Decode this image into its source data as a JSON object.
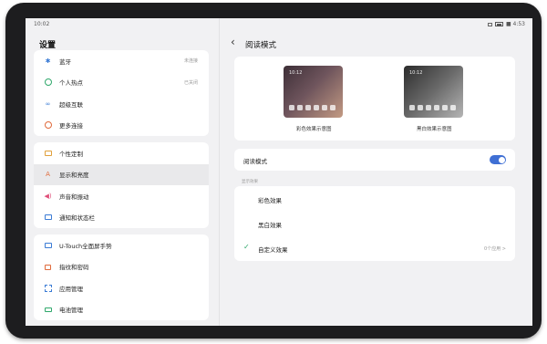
{
  "statusbar": {
    "time": "10:02",
    "battery": "■ 4:53"
  },
  "sidebar": {
    "title": "设置",
    "group1": [
      {
        "icon": "bluetooth-icon",
        "label": "蓝牙",
        "value": "未连接"
      },
      {
        "icon": "hotspot-icon",
        "label": "个人热点",
        "value": "已关闭"
      },
      {
        "icon": "super-interconnect-icon",
        "label": "超级互联",
        "value": ""
      },
      {
        "icon": "more-connections-icon",
        "label": "更多连接",
        "value": ""
      }
    ],
    "group2": [
      {
        "icon": "personalization-icon",
        "label": "个性定制"
      },
      {
        "icon": "display-brightness-icon",
        "label": "显示和亮度"
      },
      {
        "icon": "sound-vibration-icon",
        "label": "声音和振动"
      },
      {
        "icon": "notification-statusbar-icon",
        "label": "通知和状态栏"
      }
    ],
    "group3": [
      {
        "icon": "utouch-icon",
        "label": "U-Touch全面屏手势"
      },
      {
        "icon": "fingerprint-password-icon",
        "label": "指纹和密码"
      },
      {
        "icon": "app-management-icon",
        "label": "应用管理"
      },
      {
        "icon": "battery-management-icon",
        "label": "电池管理"
      }
    ]
  },
  "detail": {
    "title": "阅读模式",
    "preview": {
      "thumb_time": "10:12",
      "color_caption": "彩色效果示意图",
      "bw_caption": "黑白效果示意图"
    },
    "toggle_label": "阅读模式",
    "toggle_on": true,
    "section_label": "显示效果",
    "options": [
      {
        "label": "彩色效果",
        "checked": false,
        "trail": ""
      },
      {
        "label": "黑白效果",
        "checked": false,
        "trail": ""
      },
      {
        "label": "自定义效果",
        "checked": true,
        "trail": "0个应用 >"
      }
    ]
  },
  "colors": {
    "accent": "#3f6fd4",
    "check": "#2fa86b",
    "background": "#f1f1f3"
  }
}
